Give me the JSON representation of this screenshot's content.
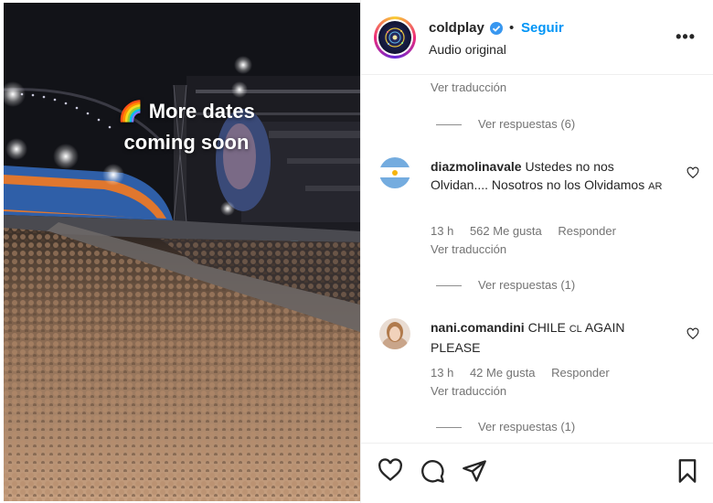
{
  "media": {
    "overlay_line1": "More dates",
    "overlay_line2": "coming soon",
    "overlay_emoji": "rainbow-icon"
  },
  "header": {
    "username": "coldplay",
    "verified": true,
    "separator": "•",
    "follow_label": "Seguir",
    "audio_label": "Audio original",
    "more_label": "•••"
  },
  "thread_top": {
    "translate": "Ver traducción",
    "replies": "Ver respuestas (6)"
  },
  "comments": [
    {
      "username": "diazmolinavale",
      "text": "Ustedes no nos Olvidan.... Nosotros no los Olvidamos",
      "flag_text": "AR",
      "time": "13 h",
      "likes": "562 Me gusta",
      "reply": "Responder",
      "translate": "Ver traducción",
      "replies": "Ver respuestas (1)",
      "avatar": "argentina-flag-avatar"
    },
    {
      "username": "nani.comandini",
      "text_before": "CHILE",
      "flag_text": "CL",
      "text_after": "AGAIN PLEASE",
      "time": "13 h",
      "likes": "42 Me gusta",
      "reply": "Responder",
      "translate": "Ver traducción",
      "replies": "Ver respuestas (1)",
      "avatar": "user-photo-avatar"
    }
  ],
  "actions": {
    "like": "heart-icon",
    "comment": "comment-icon",
    "share": "share-icon",
    "save": "bookmark-icon"
  },
  "colors": {
    "link_blue": "#0095f6",
    "muted": "#737373",
    "text": "#262626",
    "stage_blue": "#2f5fa8",
    "stage_orange": "#e0772e"
  }
}
